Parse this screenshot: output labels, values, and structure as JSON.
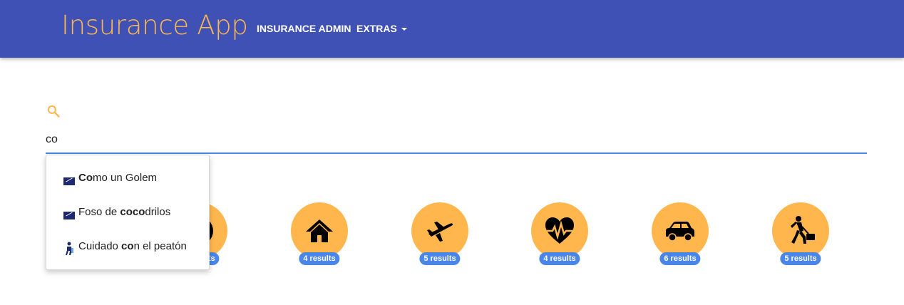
{
  "app": {
    "title": "Insurance App",
    "nav": [
      {
        "label": "INSURANCE ADMIN"
      },
      {
        "label": "EXTRAS"
      }
    ]
  },
  "search": {
    "value": "co",
    "icon": "search-icon",
    "suggestions": [
      {
        "match": "Co",
        "rest_before": "",
        "rest_after": "mo un Golem",
        "icon": "axa-logo-icon"
      },
      {
        "rest_before": "Foso de ",
        "match": "coco",
        "rest_after": "drilos",
        "icon": "axa-logo-icon"
      },
      {
        "rest_before": "Cuidado ",
        "match": "co",
        "rest_after": "n el peatón",
        "icon": "pedestrian-icon"
      }
    ]
  },
  "categories": [
    {
      "icon": "medical-cross-icon",
      "results": "5 results"
    },
    {
      "icon": "home-icon",
      "results": "4 results"
    },
    {
      "icon": "airplane-icon",
      "results": "5 results"
    },
    {
      "icon": "heart-pulse-icon",
      "results": "4 results"
    },
    {
      "icon": "car-icon",
      "results": "6 results"
    },
    {
      "icon": "traveler-icon",
      "results": "5 results"
    }
  ],
  "colors": {
    "navbar": "#3f51b5",
    "accent": "#ffb74d",
    "badge": "#4a86e8",
    "underline": "#4a86e8"
  }
}
